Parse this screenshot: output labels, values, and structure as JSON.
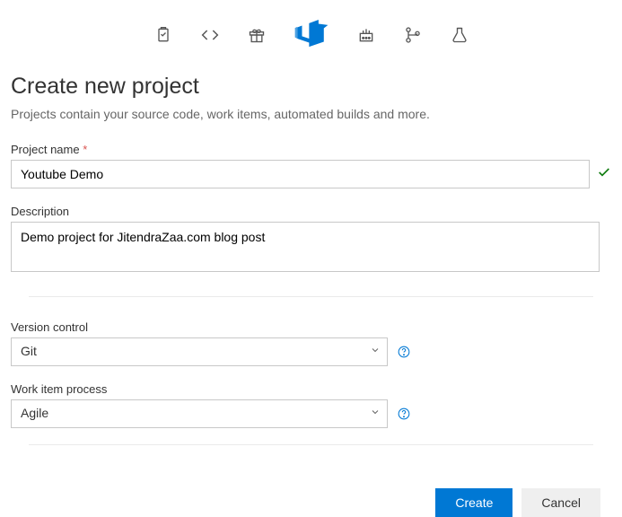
{
  "toolbar": {
    "icons": [
      "clipboard-icon",
      "code-icon",
      "gift-icon",
      "devops-logo-icon",
      "build-icon",
      "repos-icon",
      "testplans-icon"
    ]
  },
  "header": {
    "title": "Create new project",
    "subtitle": "Projects contain your source code, work items, automated builds and more."
  },
  "form": {
    "project_name_label": "Project name",
    "project_name_value": "Youtube Demo",
    "description_label": "Description",
    "description_value": "Demo project for JitendraZaa.com blog post",
    "version_control_label": "Version control",
    "version_control_value": "Git",
    "work_item_process_label": "Work item process",
    "work_item_process_value": "Agile"
  },
  "buttons": {
    "create": "Create",
    "cancel": "Cancel"
  }
}
